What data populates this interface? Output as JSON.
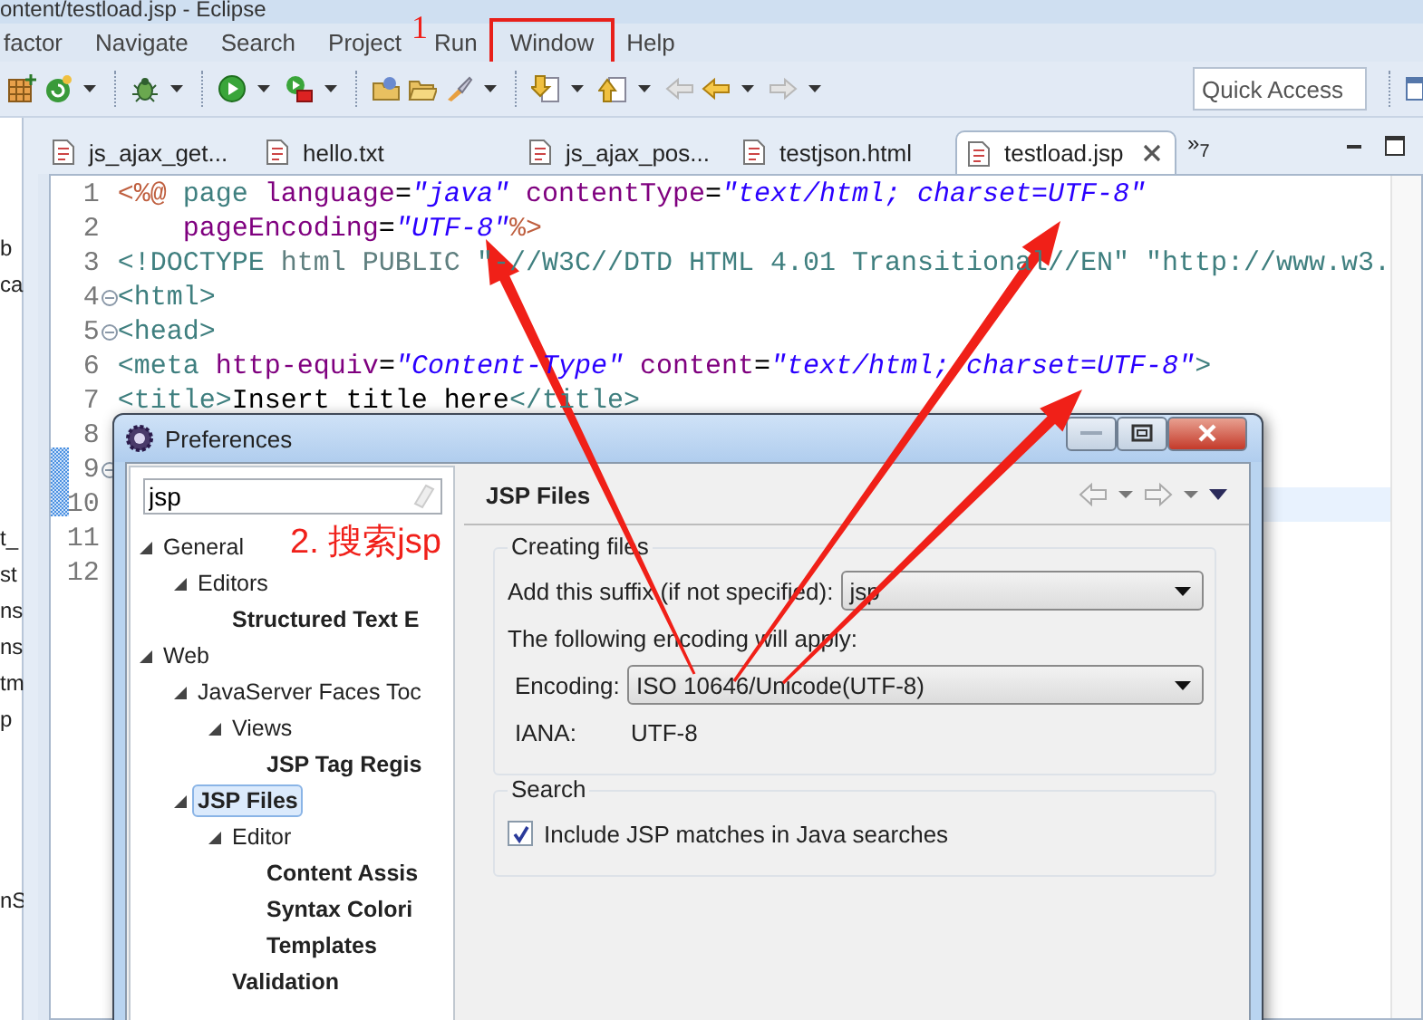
{
  "window": {
    "title": "ontent/testload.jsp - Eclipse"
  },
  "menu": [
    {
      "label": "factor",
      "annotated": false
    },
    {
      "label": "Navigate",
      "annotated": false
    },
    {
      "label": "Search",
      "annotated": false
    },
    {
      "label": "Project",
      "annotated": false
    },
    {
      "label": "Run",
      "annotated": false
    },
    {
      "label": "Window",
      "annotated": true
    },
    {
      "label": "Help",
      "annotated": false
    }
  ],
  "toolbar": {
    "quick_access": {
      "placeholder": "Quick Access"
    }
  },
  "left_panel": {
    "groups": [
      [
        "b",
        "ca"
      ],
      [
        "t_",
        "st",
        "ns",
        "ns",
        "tm",
        "p"
      ],
      [
        "nS"
      ]
    ]
  },
  "editor_tabs": {
    "tabs": [
      {
        "label": "js_ajax_get...",
        "selected": false
      },
      {
        "label": "hello.txt",
        "selected": false
      },
      {
        "label": "js_ajax_pos...",
        "selected": false
      },
      {
        "label": "testjson.html",
        "selected": false
      },
      {
        "label": "testload.jsp",
        "selected": true
      }
    ],
    "overflow": "»$_{7}$"
  },
  "editor": {
    "lines": [
      {
        "number": "1",
        "foldable": false,
        "current": false,
        "tokens": [
          {
            "kind": "directive",
            "text": "<%@"
          },
          {
            "kind": "tag",
            "text": " page"
          },
          {
            "kind": "attribute",
            "text": " language"
          },
          {
            "kind": "plain",
            "text": "="
          },
          {
            "kind": "value",
            "text": "\"java\""
          },
          {
            "kind": "attribute",
            "text": " contentType"
          },
          {
            "kind": "plain",
            "text": "="
          },
          {
            "kind": "value",
            "text": "\"text/html; charset=UTF-8\""
          }
        ]
      },
      {
        "number": "2",
        "foldable": false,
        "current": false,
        "tokens": [
          {
            "kind": "attribute",
            "text": "    pageEncoding"
          },
          {
            "kind": "plain",
            "text": "="
          },
          {
            "kind": "value",
            "text": "\"UTF-8\""
          },
          {
            "kind": "directive",
            "text": "%>"
          }
        ]
      },
      {
        "number": "3",
        "foldable": false,
        "current": false,
        "tokens": [
          {
            "kind": "tag",
            "text": "<!DOCTYPE"
          },
          {
            "kind": "keyword",
            "text": " html PUBLIC"
          },
          {
            "kind": "string",
            "text": " \"-//W3C//DTD HTML 4.01 Transitional//EN\""
          },
          {
            "kind": "string",
            "text": " \"http://www.w3."
          }
        ]
      },
      {
        "number": "4",
        "foldable": true,
        "current": false,
        "tokens": [
          {
            "kind": "tag",
            "text": "<html>"
          }
        ]
      },
      {
        "number": "5",
        "foldable": true,
        "current": false,
        "tokens": [
          {
            "kind": "tag",
            "text": "<head>"
          }
        ]
      },
      {
        "number": "6",
        "foldable": false,
        "current": false,
        "tokens": [
          {
            "kind": "tag",
            "text": "<meta"
          },
          {
            "kind": "attribute",
            "text": " http-equiv"
          },
          {
            "kind": "plain",
            "text": "="
          },
          {
            "kind": "value",
            "text": "\"Content-Type\""
          },
          {
            "kind": "attribute",
            "text": " content"
          },
          {
            "kind": "plain",
            "text": "="
          },
          {
            "kind": "value",
            "text": "\"text/html; charset=UTF-8\""
          },
          {
            "kind": "tag",
            "text": ">"
          }
        ]
      },
      {
        "number": "7",
        "foldable": false,
        "current": false,
        "tokens": [
          {
            "kind": "tag",
            "text": "<title>"
          },
          {
            "kind": "plain",
            "text": "Insert title here"
          },
          {
            "kind": "tag",
            "text": "</title>"
          }
        ]
      },
      {
        "number": "8",
        "foldable": false,
        "current": false
      },
      {
        "number": "9",
        "foldable": true,
        "current": false
      },
      {
        "number": "10",
        "foldable": false,
        "current": true
      },
      {
        "number": "11",
        "foldable": false,
        "current": false
      },
      {
        "number": "12",
        "foldable": false,
        "current": false
      }
    ]
  },
  "preferences_dialog": {
    "title": "Preferences",
    "filter": {
      "value": "jsp"
    },
    "tree": [
      {
        "label": "General",
        "expanded": true,
        "selected": false,
        "matched": false,
        "children": [
          {
            "label": "Editors",
            "expanded": true,
            "selected": false,
            "matched": false,
            "children": [
              {
                "label": "Structured Text E",
                "selected": false,
                "matched": true
              }
            ]
          }
        ]
      },
      {
        "label": "Web",
        "expanded": true,
        "selected": false,
        "matched": false,
        "children": [
          {
            "label": "JavaServer Faces Toc",
            "expanded": true,
            "selected": false,
            "matched": false,
            "children": [
              {
                "label": "Views",
                "expanded": true,
                "selected": false,
                "matched": false,
                "children": [
                  {
                    "label": "JSP Tag Regis",
                    "selected": false,
                    "matched": true
                  }
                ]
              }
            ]
          },
          {
            "label": "JSP Files",
            "expanded": true,
            "selected": true,
            "matched": true,
            "children": [
              {
                "label": "Editor",
                "expanded": true,
                "selected": false,
                "matched": false,
                "children": [
                  {
                    "label": "Content Assis",
                    "selected": false,
                    "matched": true
                  },
                  {
                    "label": "Syntax Colori",
                    "selected": false,
                    "matched": true
                  },
                  {
                    "label": "Templates",
                    "selected": false,
                    "matched": true
                  }
                ]
              },
              {
                "label": "Validation",
                "selected": false,
                "matched": true
              }
            ]
          }
        ]
      }
    ],
    "page": {
      "title": "JSP Files",
      "creating_files": {
        "title": "Creating files",
        "suffix_label": "Add this suffix (if not specified):",
        "suffix_value": "jsp",
        "encoding_note": "The following encoding will apply:",
        "encoding_label": "Encoding:",
        "encoding_value": "ISO 10646/Unicode(UTF-8)",
        "iana_label": "IANA:",
        "iana_value": "UTF-8"
      },
      "search": {
        "title": "Search",
        "include_jsp": {
          "label": "Include JSP matches in Java searches",
          "checked": true
        }
      }
    }
  },
  "annotations": {
    "step_1": "1",
    "step_2": "2. 搜索jsp"
  }
}
